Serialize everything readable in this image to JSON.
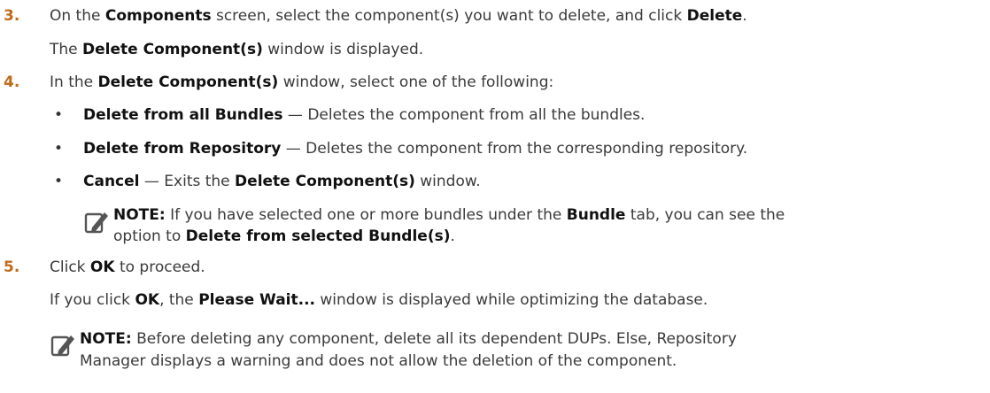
{
  "steps": [
    {
      "number": "3.",
      "line1": {
        "a": "On the ",
        "b1": "Components",
        "c": " screen, select the component(s) you want to delete, and click ",
        "b2": "Delete",
        "d": "."
      },
      "line2": {
        "a": "The ",
        "b1": "Delete Component(s)",
        "c": " window is displayed."
      }
    },
    {
      "number": "4.",
      "line1": {
        "a": "In the ",
        "b1": "Delete Component(s)",
        "c": " window, select one of the following:"
      },
      "bullets": [
        {
          "bold": "Delete from all Bundles",
          "text": " — Deletes the component from all the bundles."
        },
        {
          "bold": "Delete from Repository",
          "text": " — Deletes the component from the corresponding repository."
        },
        {
          "bold": "Cancel",
          "text": " — Exits the ",
          "bold2": "Delete Component(s)",
          "text2": " window."
        }
      ],
      "note": {
        "label": "NOTE:",
        "line1a": " If you have selected one or more bundles under the ",
        "line1b": "Bundle",
        "line1c": " tab, you can see the",
        "line2a": "option to ",
        "line2b": "Delete from selected Bundle(s)",
        "line2c": "."
      }
    },
    {
      "number": "5.",
      "line1": {
        "a": "Click ",
        "b1": "OK",
        "c": " to proceed."
      },
      "line2": {
        "a": "If you click ",
        "b1": "OK",
        "c": ", the ",
        "b2": "Please Wait...",
        "d": " window is displayed while optimizing the database."
      }
    }
  ],
  "final_note": {
    "label": "NOTE:",
    "line1": " Before deleting any component, delete all its dependent DUPs. Else, Repository",
    "line2": "Manager displays a warning and does not allow the deletion of the component."
  },
  "icons": {
    "note": "note-pencil-icon"
  },
  "colors": {
    "step_number": "#c06a1a",
    "text": "#3a3a3a"
  }
}
